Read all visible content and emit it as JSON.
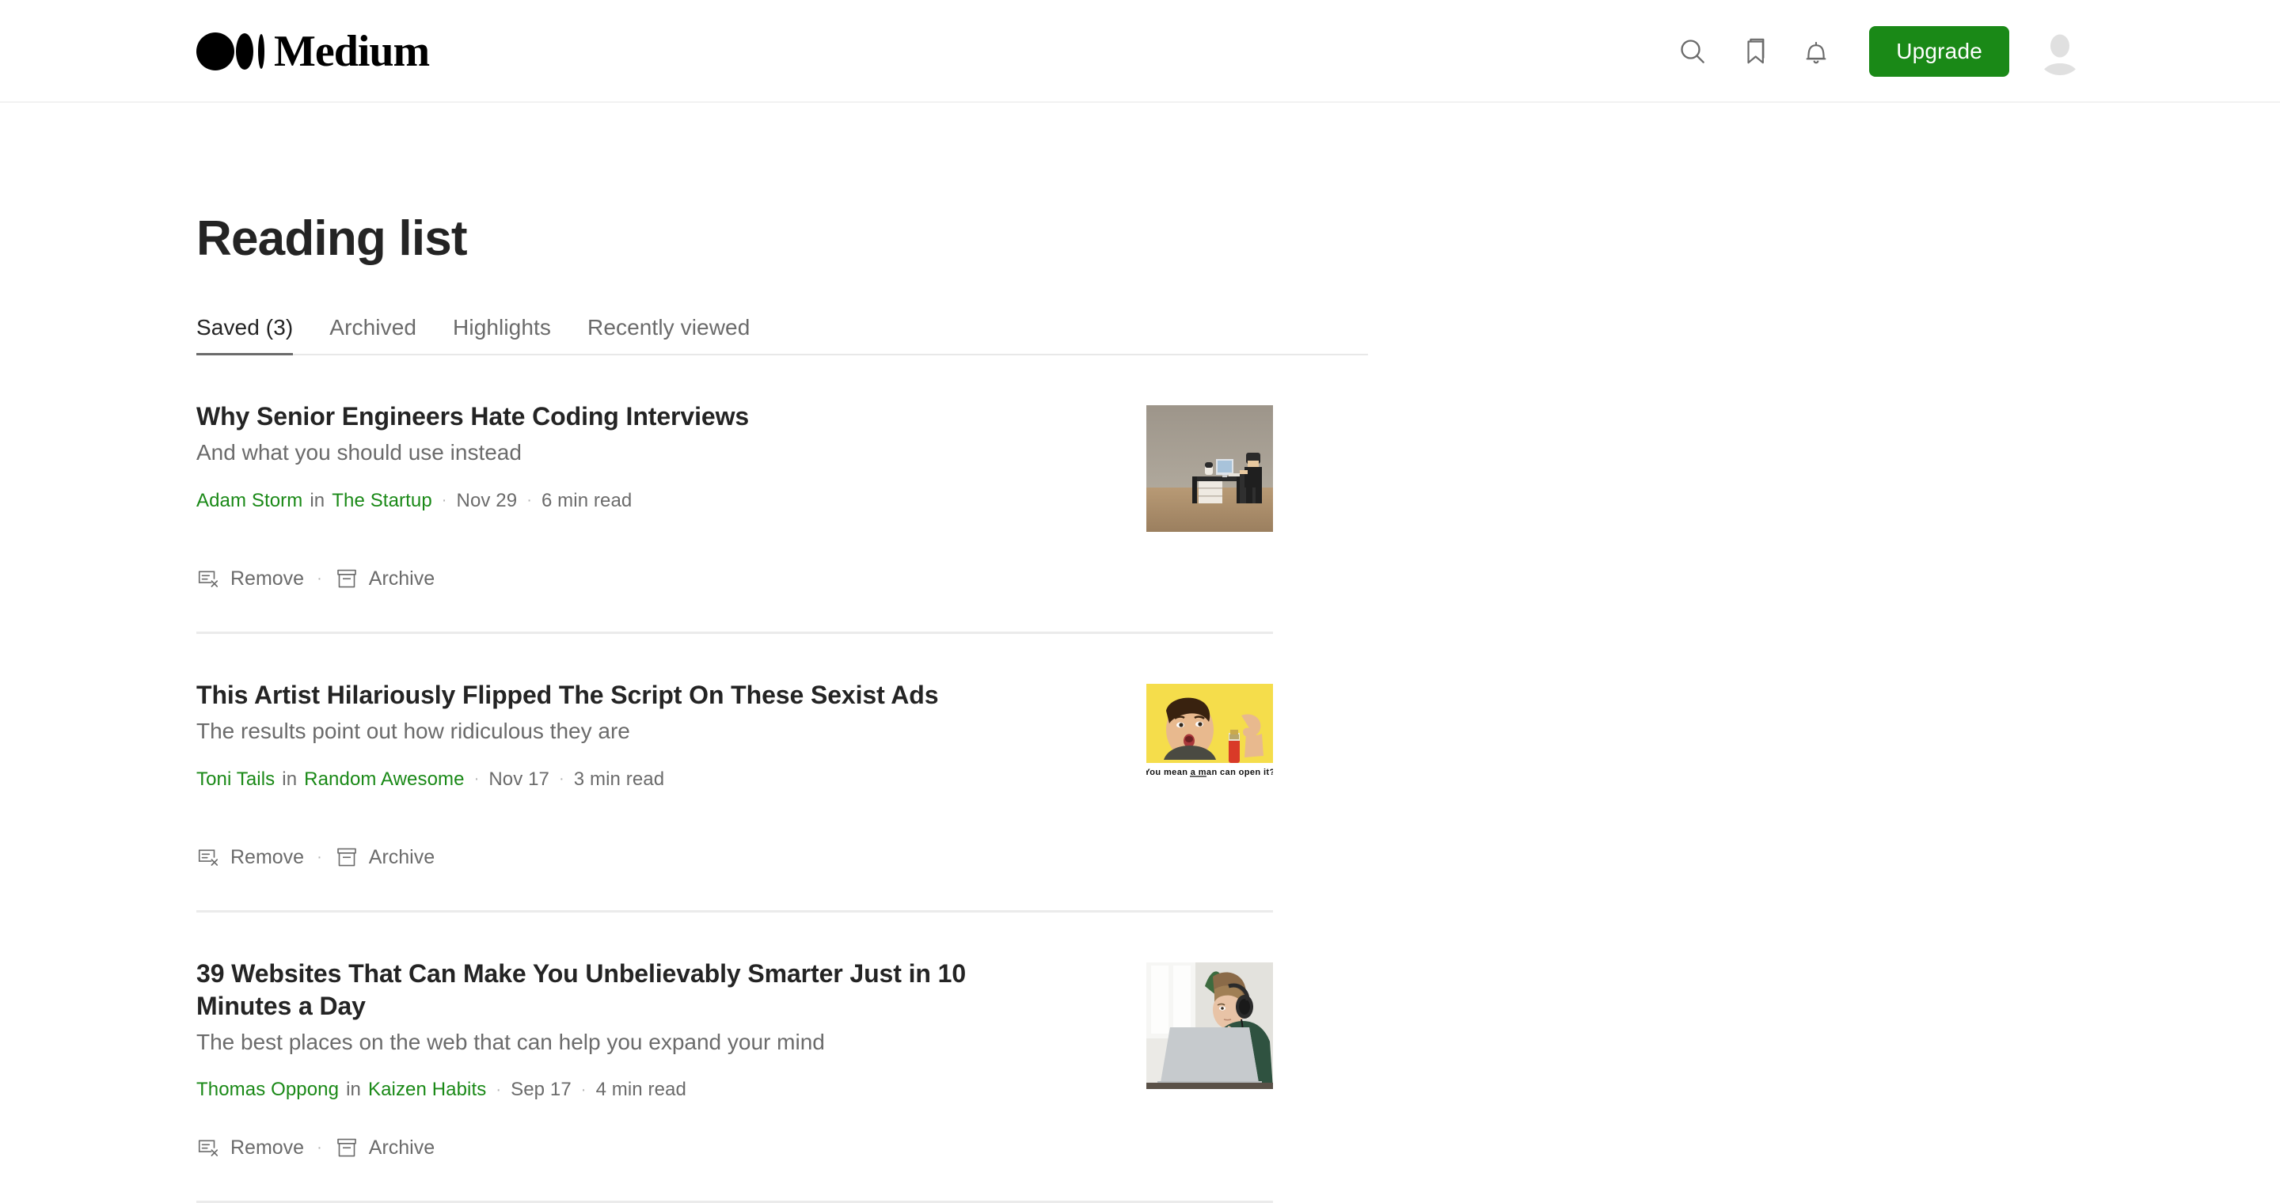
{
  "header": {
    "brand": "Medium",
    "icons": [
      {
        "name": "search-icon",
        "label": "Search"
      },
      {
        "name": "bookmark-icon",
        "label": "Reading list"
      },
      {
        "name": "bell-icon",
        "label": "Notifications"
      }
    ],
    "upgrade_label": "Upgrade",
    "avatar_label": "Account"
  },
  "page": {
    "title": "Reading list"
  },
  "tabs": [
    {
      "label": "Saved (3)",
      "active": true
    },
    {
      "label": "Archived",
      "active": false
    },
    {
      "label": "Highlights",
      "active": false
    },
    {
      "label": "Recently viewed",
      "active": false
    }
  ],
  "actions": {
    "remove_label": "Remove",
    "archive_label": "Archive",
    "separator": "·"
  },
  "meta": {
    "in_label": "in",
    "separator": "·"
  },
  "items": [
    {
      "title": "Why Senior Engineers Hate Coding Interviews",
      "subtitle": "And what you should use instead",
      "author": "Adam Storm",
      "publication": "The Startup",
      "date": "Nov 29",
      "read_time": "6 min read",
      "thumbnail": "lego-office-desk-photo"
    },
    {
      "title": "This Artist Hilariously Flipped The Script On These Sexist Ads",
      "subtitle": "The results point out how ridiculous they are",
      "author": "Toni Tails",
      "publication": "Random Awesome",
      "date": "Nov 17",
      "read_time": "3 min read",
      "thumbnail": "yellow-vintage-ad-photo",
      "thumbnail_caption": "You mean a man can open it?"
    },
    {
      "title": "39 Websites That Can Make You Unbelievably Smarter Just in 10 Minutes a Day",
      "subtitle": "The best places on the web that can help you expand your mind",
      "author": "Thomas Oppong",
      "publication": "Kaizen Habits",
      "date": "Sep 17",
      "read_time": "4 min read",
      "thumbnail": "woman-headphones-laptop-photo"
    }
  ],
  "colors": {
    "brand_green": "#1a8917",
    "text_primary": "#242424",
    "text_secondary": "#6b6b6b",
    "divider": "#ebebeb"
  }
}
